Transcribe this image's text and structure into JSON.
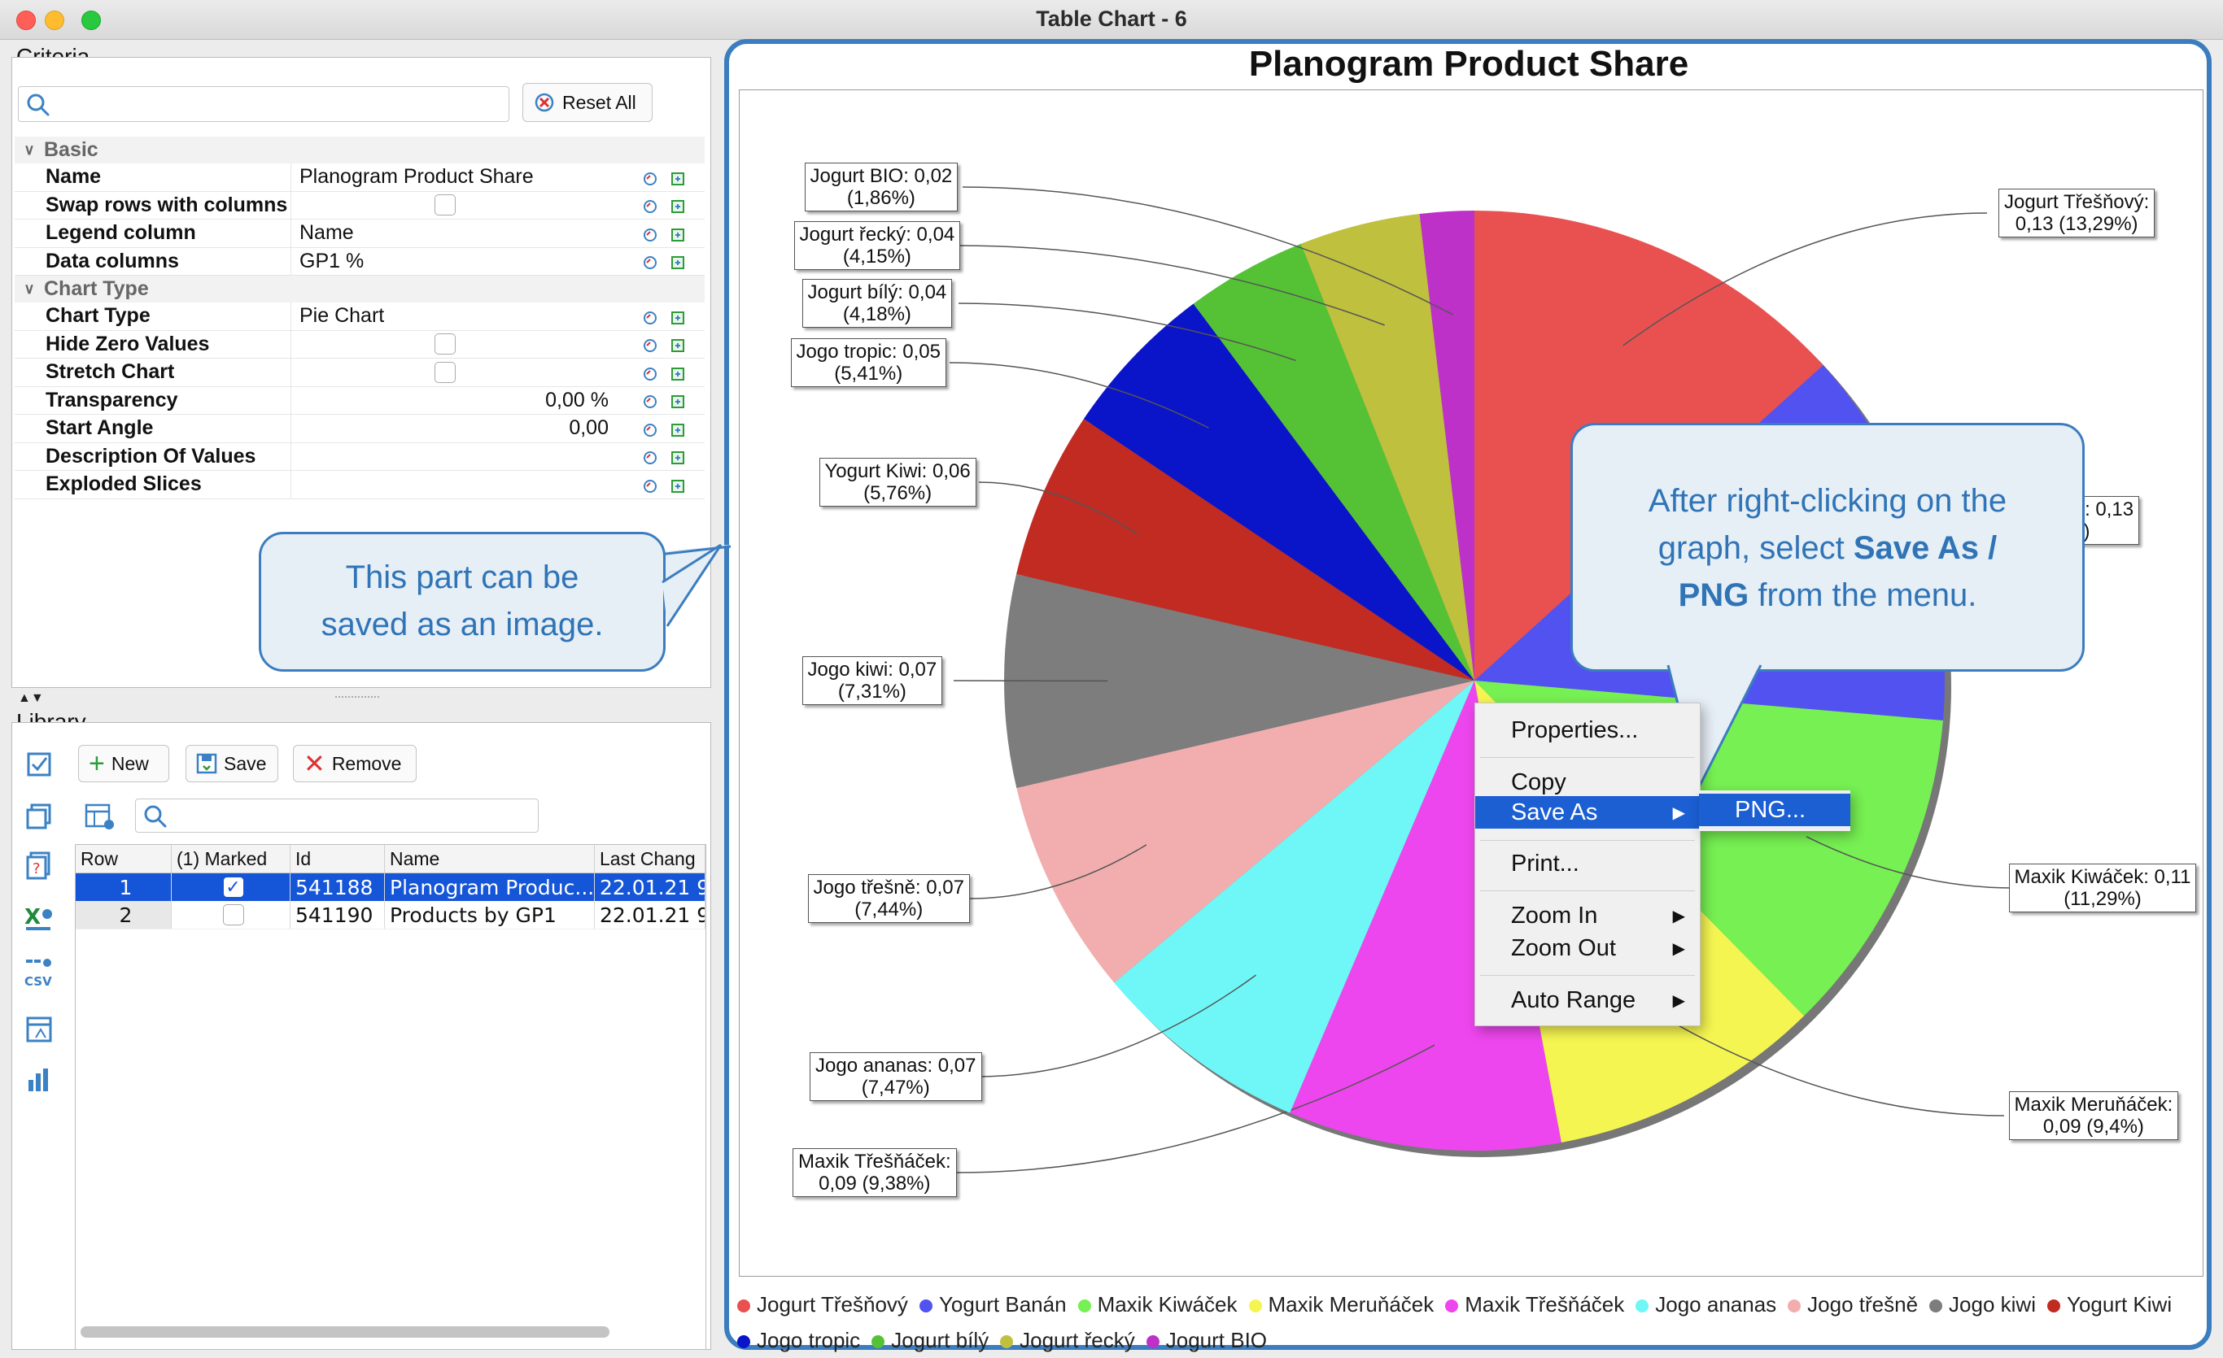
{
  "window": {
    "title": "Table Chart - 6"
  },
  "criteria": {
    "section_label": "Criteria",
    "search_placeholder": "",
    "reset_all_label": "Reset All",
    "groups": {
      "basic": "Basic",
      "chart_type": "Chart Type"
    },
    "properties": {
      "name": {
        "label": "Name",
        "value": "Planogram Product Share"
      },
      "swap": {
        "label": "Swap rows with columns"
      },
      "legend_column": {
        "label": "Legend column",
        "value": "Name"
      },
      "data_columns": {
        "label": "Data columns",
        "value": "GP1 %"
      },
      "chart_type": {
        "label": "Chart Type",
        "value": "Pie Chart"
      },
      "hide_zero": {
        "label": "Hide Zero Values"
      },
      "stretch": {
        "label": "Stretch Chart"
      },
      "transparency": {
        "label": "Transparency",
        "value": "0,00 %"
      },
      "start_angle": {
        "label": "Start Angle",
        "value": "0,00"
      },
      "description": {
        "label": "Description Of Values"
      },
      "exploded": {
        "label": "Exploded Slices"
      }
    }
  },
  "library": {
    "section_label": "Library",
    "new_label": "New",
    "save_label": "Save",
    "remove_label": "Remove",
    "columns": {
      "row": "Row",
      "marked": "(1) Marked",
      "id": "Id",
      "name": "Name",
      "last_change": "Last Chang"
    },
    "rows": [
      {
        "row": "1",
        "marked": true,
        "id": "541188",
        "name": "Planogram Produc...",
        "last_change": "22.01.21 9"
      },
      {
        "row": "2",
        "marked": false,
        "id": "541190",
        "name": "Products by GP1",
        "last_change": "22.01.21 9"
      }
    ]
  },
  "bubbles": {
    "left_line1": "This part can be",
    "left_line2": "saved as an image.",
    "right_line1": "After right-clicking on the",
    "right_line2a": "graph, select ",
    "right_line2b": "Save As /",
    "right_line3a": "PNG",
    "right_line3b": " from the menu."
  },
  "context_menu": {
    "properties": "Properties...",
    "copy": "Copy",
    "save_as": "Save As",
    "print": "Print...",
    "zoom_in": "Zoom In",
    "zoom_out": "Zoom Out",
    "auto_range": "Auto Range",
    "png": "PNG..."
  },
  "chart_data": {
    "type": "pie",
    "title": "Planogram Product Share",
    "start_angle_deg": 0,
    "slices": [
      {
        "name": "Jogurt Třešňový",
        "value": 0.13,
        "label_line1": "Jogurt Třešňový:",
        "label_line2": "0,13 (13,29%)",
        "color": "#e95151"
      },
      {
        "name": "Yogurt Banán",
        "value": 0.13,
        "label_line1": "Yogurt Banán: 0,13",
        "label_line2": "(13,06%)",
        "color": "#5252f0"
      },
      {
        "name": "Maxik Kiwáček",
        "value": 0.11,
        "label_line1": "Maxik Kiwáček: 0,11",
        "label_line2": "(11,29%)",
        "color": "#76f052"
      },
      {
        "name": "Maxik Meruňáček",
        "value": 0.09,
        "label_line1": "Maxik Meruňáček:",
        "label_line2": "0,09 (9,4%)",
        "color": "#f5f552"
      },
      {
        "name": "Maxik Třešňáček",
        "value": 0.09,
        "label_line1": "Maxik Třešňáček:",
        "label_line2": "0,09 (9,38%)",
        "color": "#ee46ee"
      },
      {
        "name": "Jogo ananas",
        "value": 0.07,
        "label_line1": "Jogo ananas: 0,07",
        "label_line2": "(7,47%)",
        "color": "#6ff7f7"
      },
      {
        "name": "Jogo třešně",
        "value": 0.07,
        "label_line1": "Jogo třešně: 0,07",
        "label_line2": "(7,44%)",
        "color": "#f2aeae"
      },
      {
        "name": "Jogo kiwi",
        "value": 0.07,
        "label_line1": "Jogo kiwi: 0,07",
        "label_line2": "(7,31%)",
        "color": "#7d7d7d"
      },
      {
        "name": "Yogurt Kiwi",
        "value": 0.06,
        "label_line1": "Yogurt Kiwi: 0,06",
        "label_line2": "(5,76%)",
        "color": "#c12b22"
      },
      {
        "name": "Jogo tropic",
        "value": 0.05,
        "label_line1": "Jogo tropic: 0,05",
        "label_line2": "(5,41%)",
        "color": "#0a14c8"
      },
      {
        "name": "Jogurt bílý",
        "value": 0.04,
        "label_line1": "Jogurt bílý: 0,04",
        "label_line2": "(4,18%)",
        "color": "#55c236"
      },
      {
        "name": "Jogurt řecký",
        "value": 0.04,
        "label_line1": "Jogurt řecký: 0,04",
        "label_line2": "(4,15%)",
        "color": "#bfc03e"
      },
      {
        "name": "Jogurt BIO",
        "value": 0.02,
        "label_line1": "Jogurt BIO: 0,02",
        "label_line2": "(1,86%)",
        "color": "#bd31c8"
      }
    ],
    "percents": [
      13.29,
      13.06,
      11.29,
      9.4,
      9.38,
      7.47,
      7.44,
      7.31,
      5.76,
      5.41,
      4.18,
      4.15,
      1.86
    ]
  }
}
